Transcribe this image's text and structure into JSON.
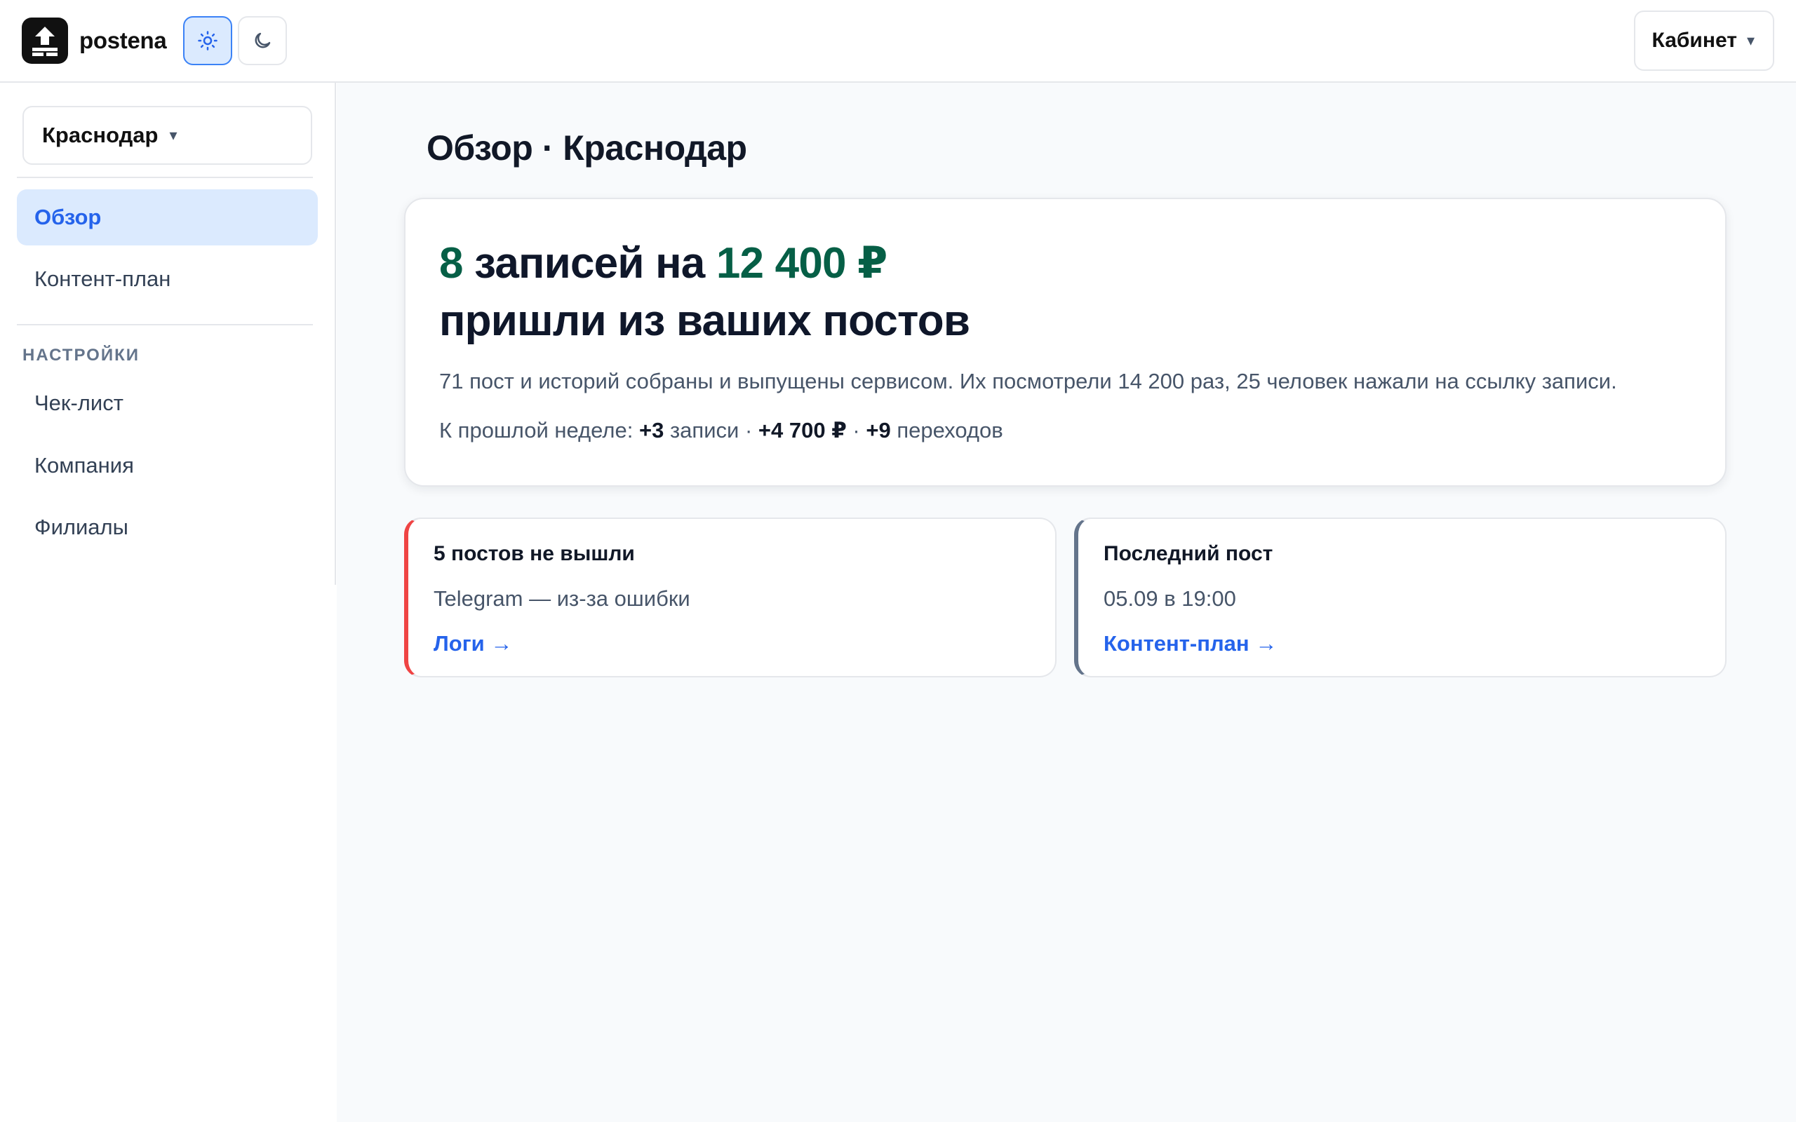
{
  "header": {
    "brand": "postena",
    "logo_icon": "upload-arrow-icon",
    "theme_light_icon": "sun-icon",
    "theme_dark_icon": "moon-icon",
    "active_theme": "light",
    "cabinet_label": "Кабинет",
    "cabinet_caret": "▾"
  },
  "sidebar": {
    "city_select": {
      "value": "Краснодар",
      "caret": "▾"
    },
    "nav": [
      {
        "label": "Обзор",
        "active": true
      },
      {
        "label": "Контент-план",
        "active": false
      }
    ],
    "settings_label": "НАСТРОЙКИ",
    "settings": [
      {
        "label": "Чек-лист"
      },
      {
        "label": "Компания"
      },
      {
        "label": "Филиалы"
      }
    ]
  },
  "main": {
    "title": "Обзор · Краснодар",
    "hero": {
      "count": "8",
      "count_text": "записей на",
      "amount": "12 400 ₽",
      "line2": "пришли из ваших постов",
      "description": "71 пост и историй собраны и выпущены сервисом. Их посмотрели 14 200 раз, 25 человек нажали на ссылку записи.",
      "week": {
        "prefix": "К прошлой неделе:",
        "records_delta": "+3",
        "records_label": "записи",
        "sep1": "·",
        "amount_delta": "+4 700 ₽",
        "sep2": "·",
        "clicks_delta": "+9",
        "clicks_label": "переходов"
      }
    },
    "cards": [
      {
        "title": "5 постов не вышли",
        "subtitle": "Telegram — из-за ошибки",
        "link": "Логи →",
        "accent": "#ef4444"
      },
      {
        "title": "Последний пост",
        "subtitle": "05.09 в 19:00",
        "link": "Контент-план →",
        "accent": "#64748b"
      }
    ]
  },
  "colors": {
    "accent_blue": "#2563eb",
    "accent_green": "#065f46",
    "error_red": "#ef4444",
    "active_bg": "#dbeafe"
  }
}
